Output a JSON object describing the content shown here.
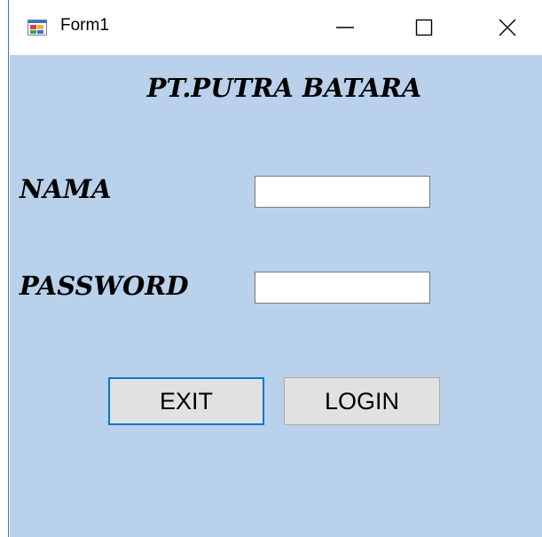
{
  "window": {
    "title": "Form1",
    "icon": "winforms-app-icon"
  },
  "titlebar_buttons": {
    "minimize": "minimize-icon",
    "maximize": "maximize-icon",
    "close": "close-icon"
  },
  "form": {
    "heading": "PT.PUTRA BATARA",
    "nama_label": "NAMA",
    "nama_value": "",
    "password_label": "PASSWORD",
    "password_value": "",
    "exit_button": "EXIT",
    "login_button": "LOGIN"
  },
  "colors": {
    "client_background": "#b9d1ea",
    "focus_border": "#0078d7",
    "button_face": "#e1e1e1"
  }
}
